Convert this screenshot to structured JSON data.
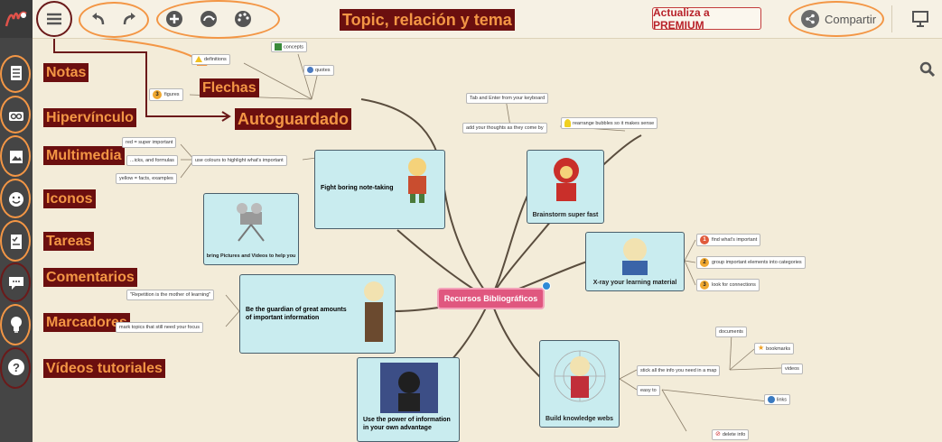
{
  "toolbar": {
    "premium_label": "Actualiza a PREMIUM",
    "share_label": "Compartir"
  },
  "annotations": {
    "topic": "Topic, relación y tema",
    "notas": "Notas",
    "flechas": "Flechas",
    "autoguardado": "Autoguardado",
    "hipervinculo": "Hipervínculo",
    "multimedia": "Multimedia",
    "iconos": "Iconos",
    "tareas": "Tareas",
    "comentarios": "Comentarios",
    "marcadores": "Marcadores",
    "videos": "Vídeos tutoriales"
  },
  "mindmap": {
    "center": "Recursos Bibliográficos",
    "cards": {
      "fight": "Fight boring note-taking",
      "pictures": "bring Pictures and Videos to help you",
      "guardian": "Be the guardian of great amounts of important information",
      "power": "Use the power of information in your own advantage",
      "brainstorm": "Brainstorm super fast",
      "xray": "X-ray your learning material",
      "webs": "Build knowledge webs"
    },
    "small": {
      "concepts": "concepts",
      "quotes": "quotes",
      "definitions": "definitions",
      "figures": "figures",
      "tab_enter": "Tab and Enter from your keyboard",
      "add_thoughts": "add your thoughts as they come by",
      "rearrange": "rearrange bubbles so it makes sense",
      "red": "red = super important",
      "blue": "...icks, and formulas",
      "yellow": "yellow = facts, examples",
      "colours": "use colours to highlight what's important",
      "repetition": "\"Repetition is the mother of learning\"",
      "mark_topics": "mark topics that still need your focus",
      "find": "find what's important",
      "group": "group important elements into categories",
      "look": "look for connections",
      "documents": "documents",
      "bookmarks": "bookmarks",
      "videos": "videos",
      "stick": "stick all the info you need in a map",
      "easy": "easy to",
      "links": "links",
      "delete": "delete info"
    },
    "numbers": [
      "1",
      "2",
      "3",
      "3"
    ]
  }
}
